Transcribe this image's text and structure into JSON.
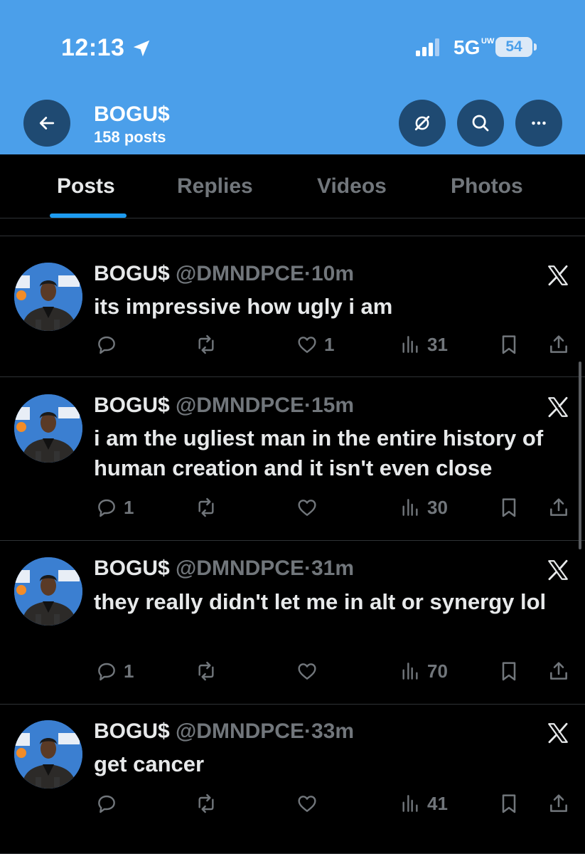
{
  "status_bar": {
    "time": "12:13",
    "network": "5G",
    "network_sup": "UW",
    "battery": "54"
  },
  "header": {
    "name": "BOGU$",
    "post_count": "158 posts"
  },
  "tabs": [
    "Posts",
    "Replies",
    "Videos",
    "Photos"
  ],
  "tweets": [
    {
      "name": "BOGU$",
      "handle": "@DMNDPCE",
      "dot": "·",
      "time": "10m",
      "text": "its impressive how ugly i am",
      "replies": "",
      "likes": "1",
      "views": "31"
    },
    {
      "name": "BOGU$",
      "handle": "@DMNDPCE",
      "dot": "·",
      "time": "15m",
      "text": "i am the ugliest man in the entire history of human creation and it isn't even close",
      "replies": "1",
      "likes": "",
      "views": "30"
    },
    {
      "name": "BOGU$",
      "handle": "@DMNDPCE",
      "dot": "·",
      "time": "31m",
      "text": "they really didn't let me in alt or synergy lol",
      "replies": "1",
      "likes": "",
      "views": "70"
    },
    {
      "name": "BOGU$",
      "handle": "@DMNDPCE",
      "dot": "·",
      "time": "33m",
      "text": "get cancer",
      "replies": "",
      "likes": "",
      "views": "41"
    }
  ],
  "colors": {
    "header_bg": "#4b9fea",
    "accent": "#1d9bf0",
    "muted": "#71767b",
    "text": "#e7e9ea"
  }
}
